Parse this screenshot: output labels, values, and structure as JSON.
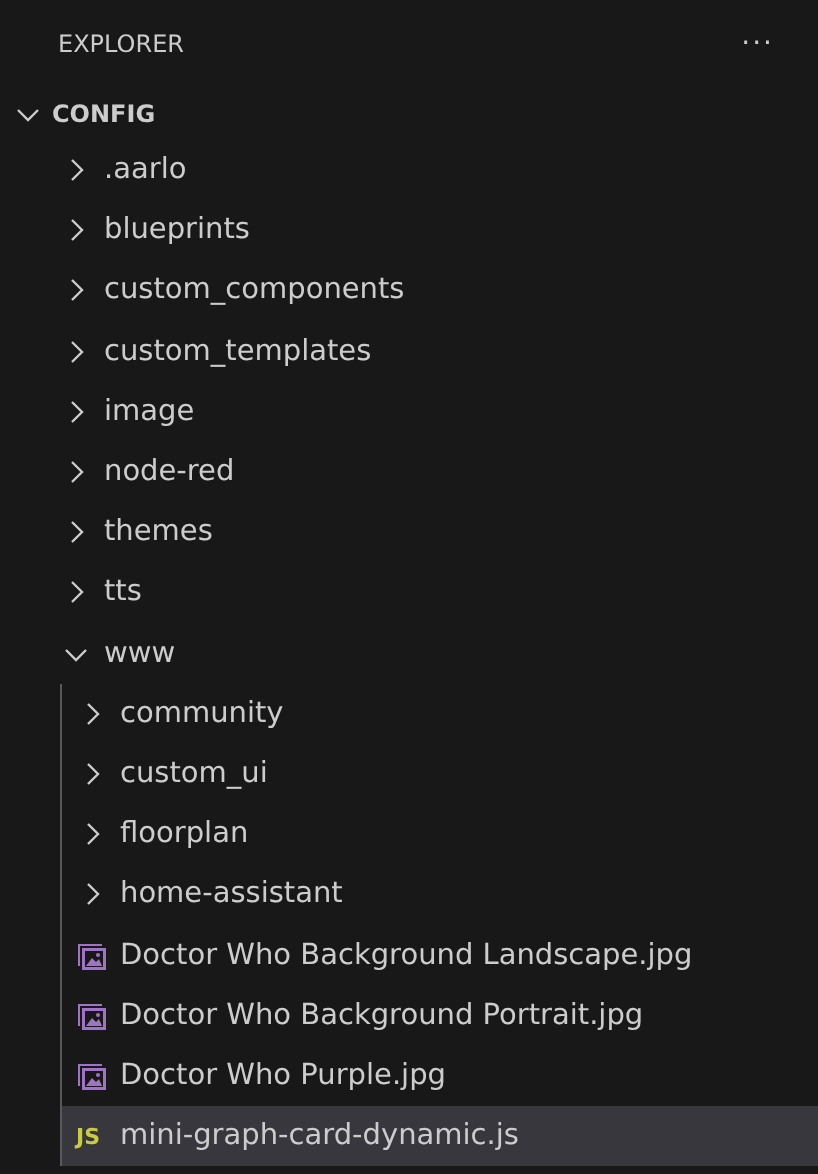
{
  "header": {
    "title": "EXPLORER",
    "more": "···"
  },
  "root": {
    "label": "CONFIG",
    "expanded": true
  },
  "tree": [
    {
      "kind": "folder",
      "label": ".aarlo",
      "expanded": false,
      "selected": false
    },
    {
      "kind": "folder",
      "label": "blueprints",
      "expanded": false,
      "selected": false
    },
    {
      "kind": "folder",
      "label": "custom_components",
      "expanded": false,
      "selected": false
    },
    {
      "kind": "folder",
      "label": "custom_templates",
      "expanded": false,
      "selected": false
    },
    {
      "kind": "folder",
      "label": "image",
      "expanded": false,
      "selected": false
    },
    {
      "kind": "folder",
      "label": "node-red",
      "expanded": false,
      "selected": false
    },
    {
      "kind": "folder",
      "label": "themes",
      "expanded": false,
      "selected": false
    },
    {
      "kind": "folder",
      "label": "tts",
      "expanded": false,
      "selected": false
    },
    {
      "kind": "folder",
      "label": "www",
      "expanded": true,
      "selected": false,
      "children": [
        {
          "kind": "folder",
          "label": "community",
          "expanded": false,
          "selected": false
        },
        {
          "kind": "folder",
          "label": "custom_ui",
          "expanded": false,
          "selected": false
        },
        {
          "kind": "folder",
          "label": "floorplan",
          "expanded": false,
          "selected": false
        },
        {
          "kind": "folder",
          "label": "home-assistant",
          "expanded": false,
          "selected": false
        },
        {
          "kind": "image",
          "label": "Doctor Who Background Landscape.jpg",
          "selected": false
        },
        {
          "kind": "image",
          "label": "Doctor Who Background Portrait.jpg",
          "selected": false
        },
        {
          "kind": "image",
          "label": "Doctor Who Purple.jpg",
          "selected": false
        },
        {
          "kind": "js",
          "badge": "JS",
          "label": "mini-graph-card-dynamic.js",
          "selected": true
        }
      ]
    }
  ]
}
